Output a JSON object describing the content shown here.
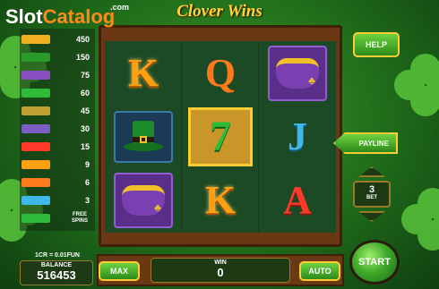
{
  "watermark": {
    "part1": "Slot",
    "part2": "Catalog",
    "suffix": ".com"
  },
  "game": {
    "title": "Clover Wins"
  },
  "paytable": [
    {
      "icon": "A-A-A-A-A",
      "value": "450",
      "color": "#f0b020"
    },
    {
      "icon": "hat-hat-hat",
      "value": "150",
      "color": "#2a9a2a"
    },
    {
      "icon": "pot-pot-pot",
      "value": "75",
      "color": "#8a4fc0"
    },
    {
      "icon": "seven-seven-seven",
      "value": "60",
      "color": "#2fbb3a"
    },
    {
      "icon": "bar-bar-bar",
      "value": "45",
      "color": "#c0a030"
    },
    {
      "icon": "shamrock-shamrock",
      "value": "30",
      "color": "#7a5fc0"
    },
    {
      "icon": "A-A-A",
      "value": "15",
      "color": "#ff3a2a"
    },
    {
      "icon": "K-K-K",
      "value": "9",
      "color": "#ffa010"
    },
    {
      "icon": "Q-Q-Q",
      "value": "6",
      "color": "#ff7a1a"
    },
    {
      "icon": "J-J-J",
      "value": "3",
      "color": "#3fb7e8"
    },
    {
      "icon": "scatter",
      "value": "",
      "free_label": "FREE SPINS",
      "color": "#2fbb3a"
    }
  ],
  "reels": {
    "col1": [
      "K",
      "hat",
      "pot"
    ],
    "col2": [
      "Q",
      "7",
      "K"
    ],
    "col3": [
      "pot",
      "J",
      "A"
    ]
  },
  "buttons": {
    "help": "HELP",
    "payline": "PAYLINE",
    "max": "MAX",
    "auto": "AUTO",
    "start": "START"
  },
  "bet": {
    "value": "3",
    "label": "BET"
  },
  "coin_info": "1CR = 0.01FUN",
  "balance": {
    "label": "BALANCE",
    "value": "516453"
  },
  "win": {
    "label": "WIN",
    "value": "0"
  }
}
